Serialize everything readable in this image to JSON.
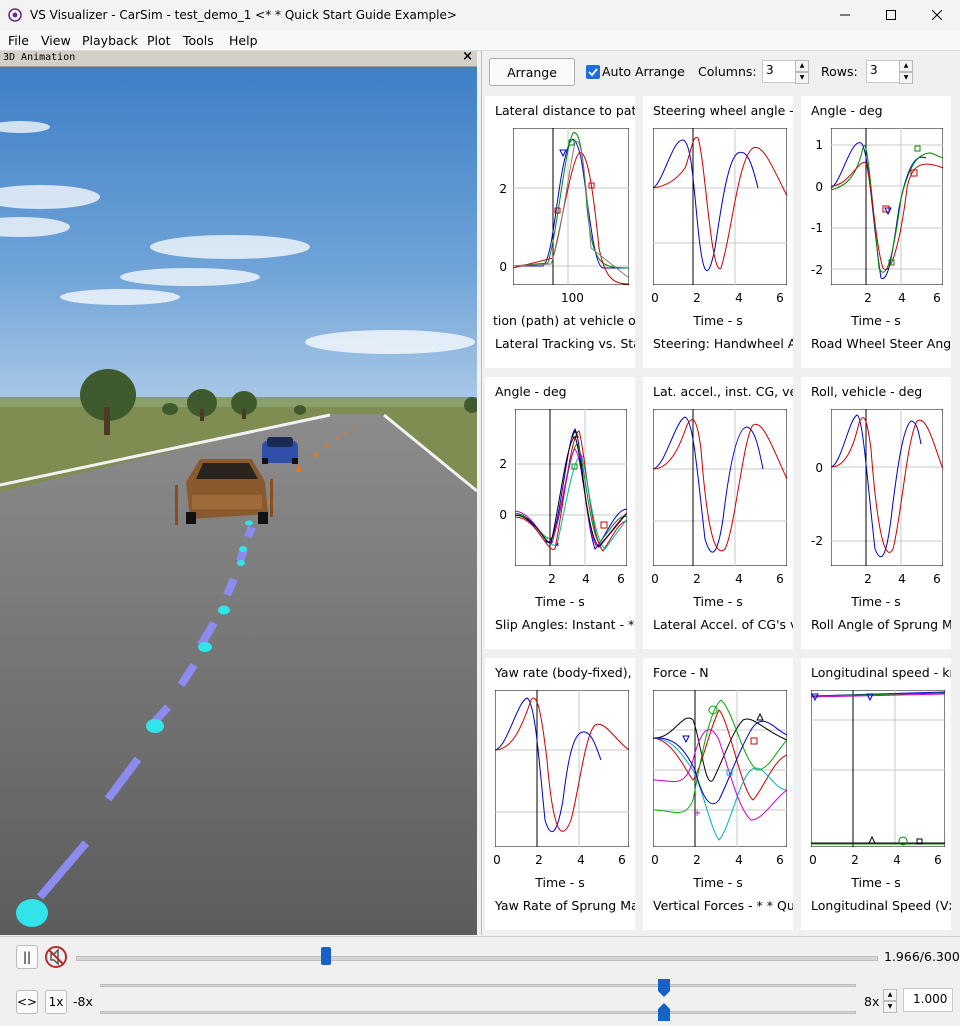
{
  "window": {
    "title": "VS Visualizer - CarSim - test_demo_1 <* * Quick Start Guide Example>",
    "controls": [
      "minimize-icon",
      "maximize-icon",
      "close-icon"
    ]
  },
  "menu": [
    "File",
    "View",
    "Playback",
    "Plot",
    "Tools",
    "Help"
  ],
  "animation": {
    "label": "3D Animation",
    "close": "×"
  },
  "plot_panel": {
    "arrange_label": "Arrange",
    "auto_arrange_label": "Auto Arrange",
    "auto_arrange_checked": true,
    "columns_label": "Columns:",
    "columns_value": "3",
    "rows_label": "Rows:",
    "rows_value": "3"
  },
  "plots": [
    {
      "title": "Lateral distance to path",
      "y_ticks": [
        "2",
        "0"
      ],
      "x_ticks": [
        "100"
      ],
      "x_axis": "tion (path) at vehicle ori",
      "legend": "Lateral Tracking vs. Sta"
    },
    {
      "title": "Steering wheel angle - c",
      "y_ticks": [],
      "x_ticks": [
        "0",
        "2",
        "4",
        "6"
      ],
      "x_axis": "Time - s",
      "legend": "Steering: Handwheel Ar"
    },
    {
      "title": "Angle - deg",
      "y_ticks": [
        "1",
        "0",
        "-1",
        "-2"
      ],
      "x_ticks": [
        "2",
        "4",
        "6"
      ],
      "x_axis": "Time - s",
      "legend": "Road Wheel Steer Ang"
    },
    {
      "title": "Angle - deg",
      "y_ticks": [
        "2",
        "0"
      ],
      "x_ticks": [
        "2",
        "4",
        "6"
      ],
      "x_axis": "Time - s",
      "legend": "Slip Angles: Instant - *"
    },
    {
      "title": "Lat. accel., inst. CG, ve",
      "y_ticks": [],
      "x_ticks": [
        "0",
        "2",
        "4",
        "6"
      ],
      "x_axis": "Time - s",
      "legend": "Lateral Accel. of CG's v"
    },
    {
      "title": "Roll, vehicle - deg",
      "y_ticks": [
        "0",
        "-2"
      ],
      "x_ticks": [
        "2",
        "4",
        "6"
      ],
      "x_axis": "Time - s",
      "legend": "Roll Angle of Sprung M"
    },
    {
      "title": "Yaw rate (body-fixed), v",
      "y_ticks": [],
      "x_ticks": [
        "0",
        "2",
        "4",
        "6"
      ],
      "x_axis": "Time - s",
      "legend": "Yaw Rate of Sprung Ma"
    },
    {
      "title": "Force - N",
      "y_ticks": [],
      "x_ticks": [
        "0",
        "2",
        "4",
        "6"
      ],
      "x_axis": "Time - s",
      "legend": "Vertical Forces - * * Qu"
    },
    {
      "title": "Longitudinal speed - km",
      "y_ticks": [],
      "x_ticks": [
        "0",
        "2",
        "4",
        "6"
      ],
      "x_axis": "Time - s",
      "legend": "Longitudinal Speed (Vx"
    }
  ],
  "transport": {
    "pause_label": "||",
    "time_readout": "1.966/6.300",
    "time_position": 0.312,
    "loop_label": "<>",
    "rate_label": "1x",
    "min_speed": "-8x",
    "max_speed": "8x",
    "speed_value": "1.000"
  },
  "colors": {
    "accent": "#1461c7",
    "sky_top": "#3d7fc7",
    "grass": "#7a8a4a",
    "road": "#6b6b6b",
    "path_marker": "#8888ee",
    "target_marker": "#33e0e8"
  }
}
